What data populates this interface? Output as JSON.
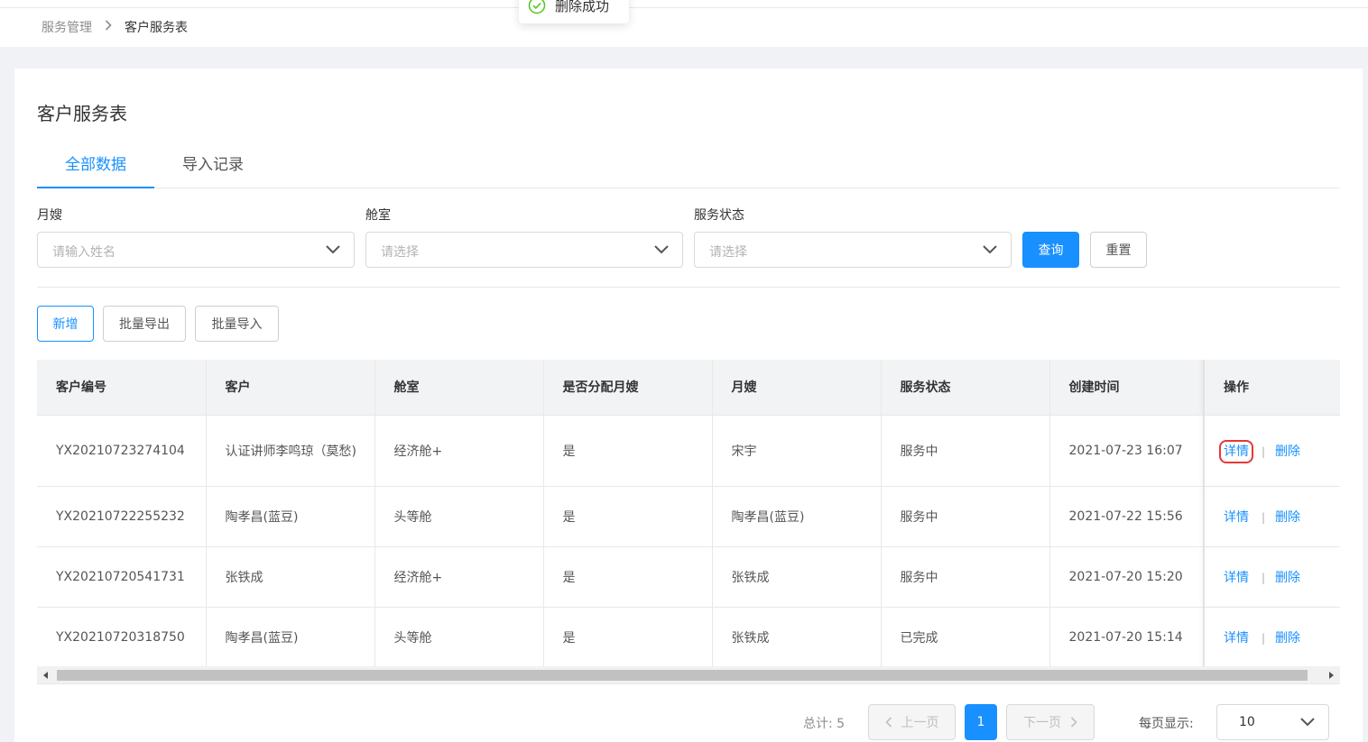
{
  "breadcrumb": {
    "parent": "服务管理",
    "current": "客户服务表"
  },
  "toast": {
    "text": "删除成功"
  },
  "page": {
    "title": "客户服务表"
  },
  "tabs": [
    {
      "label": "全部数据",
      "active": true
    },
    {
      "label": "导入记录",
      "active": false
    }
  ],
  "filters": {
    "yuesao": {
      "label": "月嫂",
      "placeholder": "请输入姓名"
    },
    "cangshi": {
      "label": "舱室",
      "placeholder": "请选择"
    },
    "status": {
      "label": "服务状态",
      "placeholder": "请选择"
    },
    "query_label": "查询",
    "reset_label": "重置"
  },
  "actions": {
    "add_label": "新增",
    "export_label": "批量导出",
    "import_label": "批量导入"
  },
  "table": {
    "columns": [
      "客户编号",
      "客户",
      "舱室",
      "是否分配月嫂",
      "月嫂",
      "服务状态",
      "创建时间",
      "操作"
    ],
    "rows": [
      {
        "id": "YX20210723274104",
        "customer": "认证讲师李鸣琼（莫愁)",
        "room": "经济舱+",
        "assigned": "是",
        "yuesao": "宋宇",
        "status": "服务中",
        "created": "2021-07-23 16:07"
      },
      {
        "id": "YX20210722255232",
        "customer": "陶孝昌(蓝豆)",
        "room": "头等舱",
        "assigned": "是",
        "yuesao": "陶孝昌(蓝豆)",
        "status": "服务中",
        "created": "2021-07-22 15:56"
      },
      {
        "id": "YX20210720541731",
        "customer": "张铁成",
        "room": "经济舱+",
        "assigned": "是",
        "yuesao": "张铁成",
        "status": "服务中",
        "created": "2021-07-20 15:20"
      },
      {
        "id": "YX20210720318750",
        "customer": "陶孝昌(蓝豆)",
        "room": "头等舱",
        "assigned": "是",
        "yuesao": "张铁成",
        "status": "已完成",
        "created": "2021-07-20 15:14"
      }
    ],
    "op_detail": "详情",
    "op_sep": "|",
    "op_delete": "删除"
  },
  "pagination": {
    "total_text": "总计: 5",
    "prev_label": "上一页",
    "current_page": "1",
    "next_label": "下一页",
    "per_page_label": "每页显示:",
    "per_page_value": "10"
  },
  "colors": {
    "primary": "#1890ff",
    "highlight": "#e53935"
  }
}
